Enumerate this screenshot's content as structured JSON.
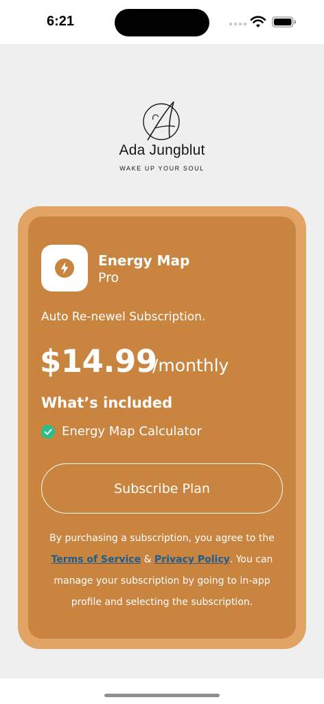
{
  "status_bar": {
    "time": "6:21",
    "icons": [
      "cellular-signal-icon",
      "wifi-icon",
      "battery-icon"
    ]
  },
  "brand": {
    "name": "Ada Jungblut",
    "tagline": "WAKE UP YOUR SOUL",
    "logo_icon": "ada-monogram-logo"
  },
  "product": {
    "icon": "lightning-bolt-icon",
    "name": "Energy Map",
    "tier": "Pro",
    "subscription_type": "Auto Re-newel Subscription.",
    "price": "$14.99",
    "period": "/monthly",
    "included_heading": "What’s included",
    "features": [
      {
        "label": "Energy Map Calculator",
        "icon": "check-circle-icon"
      }
    ]
  },
  "actions": {
    "subscribe_label": "Subscribe Plan"
  },
  "legal": {
    "text_1": "By purchasing a subscription, you agree to the ",
    "terms_label": "Terms of Service",
    "amp": " & ",
    "privacy_label": "Privacy Policy",
    "text_2": ". You can manage your subscription by going to in-app profile and selecting the subscription."
  },
  "colors": {
    "card_outer": "#e1a465",
    "card_inner": "#c98540",
    "check": "#2ebd8a",
    "link": "#1f5c8c",
    "background": "#efefef"
  }
}
